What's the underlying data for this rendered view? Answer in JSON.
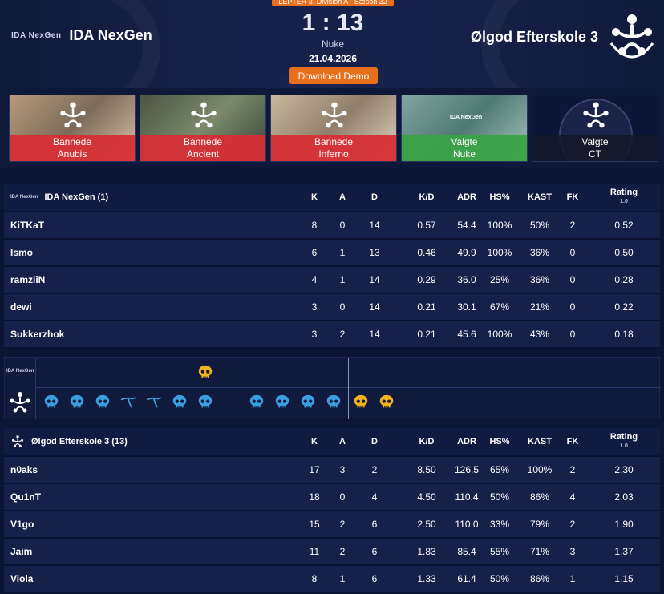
{
  "header": {
    "division": "LEPTER 3. Division A - Sæson 32",
    "score_left": "1",
    "score_sep": ":",
    "score_right": "13",
    "map": "Nuke",
    "date": "21.04.2026",
    "download_label": "Download Demo",
    "team_left": {
      "name": "IDA NexGen",
      "logo_text": "IDA NexGen"
    },
    "team_right": {
      "name": "Ølgod Efterskole 3"
    }
  },
  "veto": [
    {
      "action": "Bannede",
      "map": "Anubis",
      "type": "ban"
    },
    {
      "action": "Bannede",
      "map": "Ancient",
      "type": "ban"
    },
    {
      "action": "Bannede",
      "map": "Inferno",
      "type": "ban"
    },
    {
      "action": "Valgte",
      "map": "Nuke",
      "type": "pick"
    },
    {
      "action": "Valgte",
      "map": "CT",
      "type": "side"
    }
  ],
  "columns": {
    "k": "K",
    "a": "A",
    "d": "D",
    "kd": "K/D",
    "adr": "ADR",
    "hs": "HS%",
    "kast": "KAST",
    "fk": "FK",
    "rating": "Rating",
    "rating_sub": "1.0"
  },
  "team1_table": {
    "title": "IDA NexGen (1)",
    "logo_text": "IDA NexGen",
    "players": [
      {
        "name": "KiTKaT",
        "k": "8",
        "a": "0",
        "d": "14",
        "kd": "0.57",
        "adr": "54.4",
        "hs": "100%",
        "kast": "50%",
        "fk": "2",
        "rating": "0.52"
      },
      {
        "name": "Ismo",
        "k": "6",
        "a": "1",
        "d": "13",
        "kd": "0.46",
        "adr": "49.9",
        "hs": "100%",
        "kast": "36%",
        "fk": "0",
        "rating": "0.50"
      },
      {
        "name": "ramziiN",
        "k": "4",
        "a": "1",
        "d": "14",
        "kd": "0.29",
        "adr": "36.0",
        "hs": "25%",
        "kast": "36%",
        "fk": "0",
        "rating": "0.28"
      },
      {
        "name": "dewi",
        "k": "3",
        "a": "0",
        "d": "14",
        "kd": "0.21",
        "adr": "30.1",
        "hs": "67%",
        "kast": "21%",
        "fk": "0",
        "rating": "0.22"
      },
      {
        "name": "Sukkerzhok",
        "k": "3",
        "a": "2",
        "d": "14",
        "kd": "0.21",
        "adr": "45.6",
        "hs": "100%",
        "kast": "43%",
        "fk": "0",
        "rating": "0.18"
      }
    ]
  },
  "timeline": {
    "team1_logo_text": "IDA NexGen",
    "team1_rounds": [
      {
        "round": 7,
        "icon": "skull-gold"
      }
    ],
    "team2_rounds": [
      {
        "round": 1,
        "icon": "skull-blue"
      },
      {
        "round": 2,
        "icon": "skull-blue"
      },
      {
        "round": 3,
        "icon": "skull-blue"
      },
      {
        "round": 4,
        "icon": "defuse-blue"
      },
      {
        "round": 5,
        "icon": "defuse-blue"
      },
      {
        "round": 6,
        "icon": "skull-blue"
      },
      {
        "round": 7,
        "icon": "skull-blue"
      },
      {
        "round": 9,
        "icon": "skull-blue"
      },
      {
        "round": 10,
        "icon": "skull-blue"
      },
      {
        "round": 11,
        "icon": "skull-blue"
      },
      {
        "round": 12,
        "icon": "skull-blue"
      },
      {
        "round": 13,
        "icon": "skull-gold"
      },
      {
        "round": 14,
        "icon": "skull-gold"
      }
    ]
  },
  "team2_table": {
    "title": "Ølgod Efterskole 3 (13)",
    "players": [
      {
        "name": "n0aks",
        "k": "17",
        "a": "3",
        "d": "2",
        "kd": "8.50",
        "adr": "126.5",
        "hs": "65%",
        "kast": "100%",
        "fk": "2",
        "rating": "2.30"
      },
      {
        "name": "Qu1nT",
        "k": "18",
        "a": "0",
        "d": "4",
        "kd": "4.50",
        "adr": "110.4",
        "hs": "50%",
        "kast": "86%",
        "fk": "4",
        "rating": "2.03"
      },
      {
        "name": "V1go",
        "k": "15",
        "a": "2",
        "d": "6",
        "kd": "2.50",
        "adr": "110.0",
        "hs": "33%",
        "kast": "79%",
        "fk": "2",
        "rating": "1.90"
      },
      {
        "name": "Jaim",
        "k": "11",
        "a": "2",
        "d": "6",
        "kd": "1.83",
        "adr": "85.4",
        "hs": "55%",
        "kast": "71%",
        "fk": "3",
        "rating": "1.37"
      },
      {
        "name": "Viola",
        "k": "8",
        "a": "1",
        "d": "6",
        "kd": "1.33",
        "adr": "61.4",
        "hs": "50%",
        "kast": "86%",
        "fk": "1",
        "rating": "1.15"
      }
    ]
  },
  "colors": {
    "accent": "#e8701c",
    "ban": "#d62f35",
    "pick": "#3aa347",
    "skull_blue": "#3b9ee0",
    "skull_gold": "#f2b21b"
  }
}
